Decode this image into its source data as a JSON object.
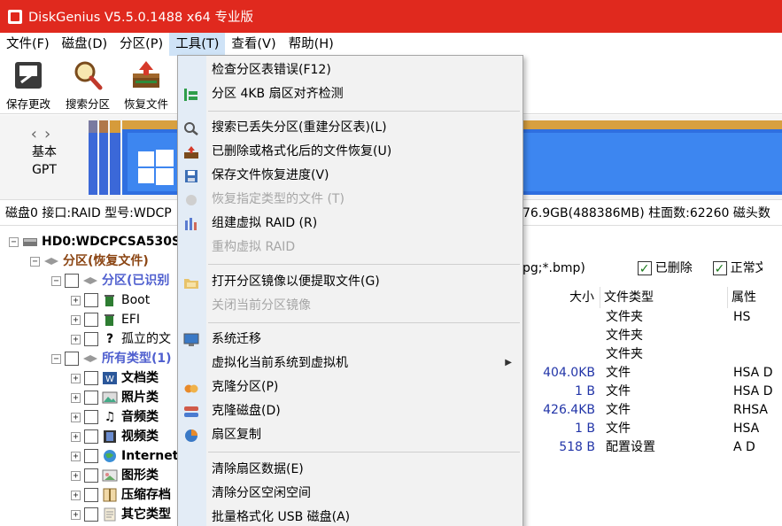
{
  "window": {
    "title": "DiskGenius V5.5.0.1488 x64 专业版"
  },
  "menubar": {
    "items": [
      {
        "label": "文件(F)"
      },
      {
        "label": "磁盘(D)"
      },
      {
        "label": "分区(P)"
      },
      {
        "label": "工具(T)"
      },
      {
        "label": "查看(V)"
      },
      {
        "label": "帮助(H)"
      }
    ]
  },
  "toolbar": {
    "save_label": "保存更改",
    "search_label": "搜索分区",
    "recover_label": "恢复文件"
  },
  "diskbar": {
    "basic": "基本",
    "gpt": "GPT"
  },
  "infoline": {
    "left": "磁盘0 接口:RAID  型号:WDCP",
    "right": "76.9GB(488386MB) 柱面数:62260 磁头数"
  },
  "tree": {
    "disk": "HD0:WDCPCSA530S",
    "partition_recover": "分区(恢复文件)",
    "partition_identified": "分区(已识别",
    "boot": "Boot",
    "efi": "EFI",
    "orphan": "孤立的文",
    "all_types": "所有类型(1)",
    "documents": "文档类",
    "photos": "照片类",
    "audio": "音频类",
    "video": "视频类",
    "internet": "Internet",
    "graphics": "图形类",
    "archives": "压缩存档",
    "others": "其它类型"
  },
  "filter": {
    "ext_tail": "pg;*.bmp)",
    "deleted_label": "已删除",
    "normal_label": "正常文件"
  },
  "file_table": {
    "headers": {
      "size": "大小",
      "type": "文件类型",
      "attr": "属性"
    },
    "rows": [
      {
        "size": "",
        "type": "文件夹",
        "attr": "HS"
      },
      {
        "size": "",
        "type": "文件夹",
        "attr": ""
      },
      {
        "size": "",
        "type": "文件夹",
        "attr": ""
      },
      {
        "size": "404.0KB",
        "type": "文件",
        "attr": "HSA D"
      },
      {
        "size": "1 B",
        "type": "文件",
        "attr": "HSA D"
      },
      {
        "size": "426.4KB",
        "type": "文件",
        "attr": "RHSA"
      },
      {
        "size": "1 B",
        "type": "文件",
        "attr": "HSA"
      },
      {
        "size": "518 B",
        "type": "配置设置",
        "attr": "A D"
      }
    ]
  },
  "tools_menu": {
    "items": [
      {
        "label": "检查分区表错误(F12)",
        "enabled": true,
        "icon": ""
      },
      {
        "label": "分区 4KB 扇区对齐检测",
        "enabled": true,
        "icon": "align-check-icon"
      },
      {
        "label": "搜索已丢失分区(重建分区表)(L)",
        "enabled": true,
        "icon": "magnifier-icon"
      },
      {
        "label": "已删除或格式化后的文件恢复(U)",
        "enabled": true,
        "icon": "recover-icon"
      },
      {
        "label": "保存文件恢复进度(V)",
        "enabled": true,
        "icon": "floppy-icon"
      },
      {
        "label": "恢复指定类型的文件 (T)",
        "enabled": false,
        "icon": "filetype-icon"
      },
      {
        "label": "组建虚拟 RAID (R)",
        "enabled": true,
        "icon": "raid-icon"
      },
      {
        "label": "重构虚拟 RAID",
        "enabled": false,
        "icon": ""
      },
      {
        "label": "打开分区镜像以便提取文件(G)",
        "enabled": true,
        "icon": "open-image-icon"
      },
      {
        "label": "关闭当前分区镜像",
        "enabled": false,
        "icon": ""
      },
      {
        "label": "系统迁移",
        "enabled": true,
        "icon": "monitor-icon"
      },
      {
        "label": "虚拟化当前系统到虚拟机",
        "enabled": true,
        "icon": ""
      },
      {
        "label": "克隆分区(P)",
        "enabled": true,
        "icon": "clone-partition-icon"
      },
      {
        "label": "克隆磁盘(D)",
        "enabled": true,
        "icon": "clone-disk-icon"
      },
      {
        "label": "扇区复制",
        "enabled": true,
        "icon": "sector-copy-icon"
      },
      {
        "label": "清除扇区数据(E)",
        "enabled": true,
        "icon": ""
      },
      {
        "label": "清除分区空闲空间",
        "enabled": true,
        "icon": ""
      },
      {
        "label": "批量格式化 USB 磁盘(A)",
        "enabled": true,
        "icon": ""
      }
    ]
  },
  "colors": {
    "titlebar": "#e0291e",
    "menu_background": "#f2f2f2",
    "menu_gutter": "#e3ecf6",
    "disabled_text": "#a6a6a6",
    "size_text": "#2235a8"
  }
}
